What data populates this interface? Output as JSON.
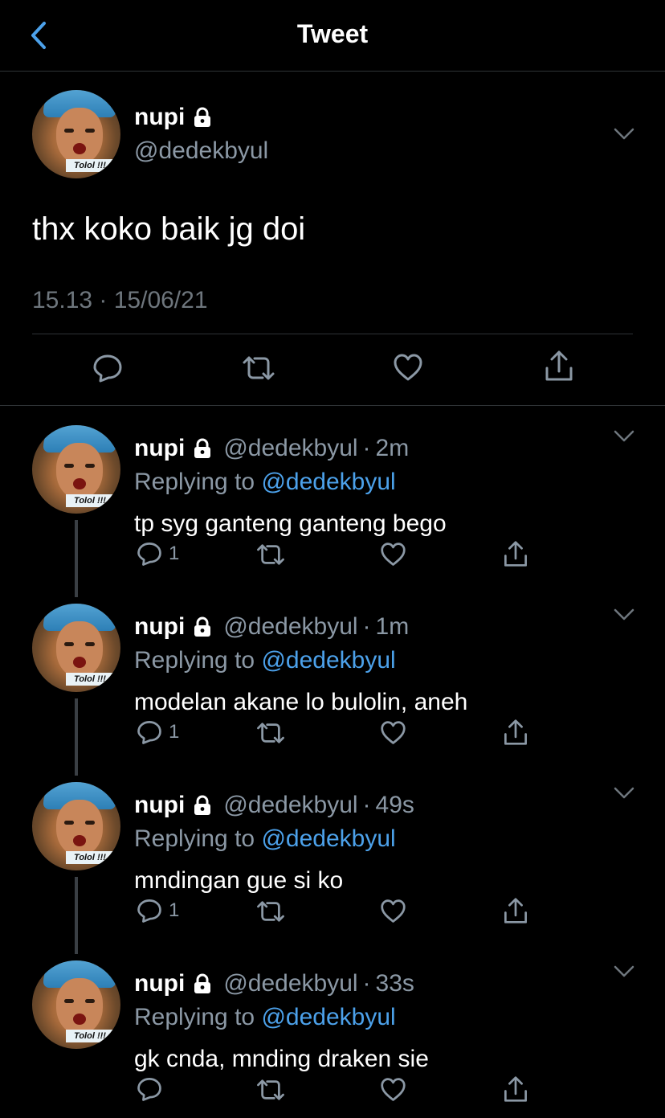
{
  "header": {
    "title": "Tweet",
    "back_icon": "chevron-left-icon"
  },
  "colors": {
    "background": "#000000",
    "accent": "#4ca1ea",
    "secondary_text": "#8b98a5",
    "divider": "#2f3336"
  },
  "main_tweet": {
    "name": "nupi",
    "handle": "@dedekbyul",
    "avatar_caption": "Tolol !!!",
    "text": "thx koko baik jg doi",
    "timestamp": "15.13 · 15/06/21",
    "actions": [
      "reply-icon",
      "retweet-icon",
      "like-icon",
      "share-icon"
    ]
  },
  "replies": [
    {
      "name": "nupi",
      "handle": "@dedekbyul",
      "dot": "·",
      "time": "2m",
      "replying_label": "Replying to",
      "replying_to": "@dedekbyul",
      "text": "tp syg ganteng ganteng bego",
      "reply_count": "1",
      "avatar_caption": "Tolol !!!"
    },
    {
      "name": "nupi",
      "handle": "@dedekbyul",
      "dot": "·",
      "time": "1m",
      "replying_label": "Replying to",
      "replying_to": "@dedekbyul",
      "text": "modelan akane lo bulolin, aneh",
      "reply_count": "1",
      "avatar_caption": "Tolol !!!"
    },
    {
      "name": "nupi",
      "handle": "@dedekbyul",
      "dot": "·",
      "time": "49s",
      "replying_label": "Replying to",
      "replying_to": "@dedekbyul",
      "text": "mndingan gue si ko",
      "reply_count": "1",
      "avatar_caption": "Tolol !!!"
    },
    {
      "name": "nupi",
      "handle": "@dedekbyul",
      "dot": "·",
      "time": "33s",
      "replying_label": "Replying to",
      "replying_to": "@dedekbyul",
      "text": "gk cnda, mnding draken sie",
      "reply_count": "",
      "avatar_caption": "Tolol !!!"
    }
  ]
}
